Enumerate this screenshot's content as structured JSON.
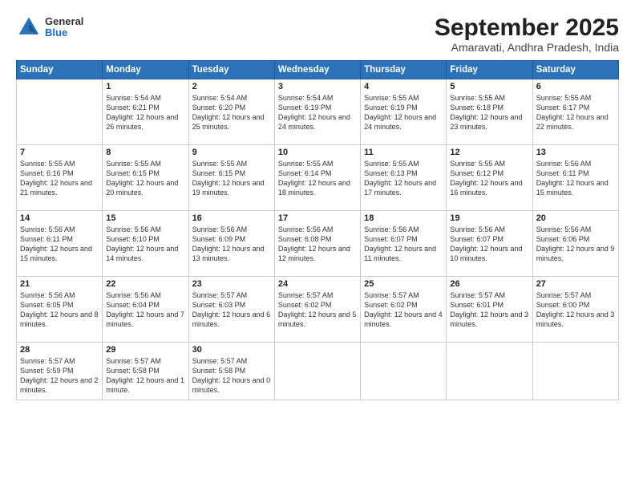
{
  "logo": {
    "general": "General",
    "blue": "Blue"
  },
  "header": {
    "month": "September 2025",
    "location": "Amaravati, Andhra Pradesh, India"
  },
  "days_of_week": [
    "Sunday",
    "Monday",
    "Tuesday",
    "Wednesday",
    "Thursday",
    "Friday",
    "Saturday"
  ],
  "weeks": [
    [
      {
        "day": "",
        "empty": true
      },
      {
        "day": "1",
        "sunrise": "Sunrise: 5:54 AM",
        "sunset": "Sunset: 6:21 PM",
        "daylight": "Daylight: 12 hours and 26 minutes."
      },
      {
        "day": "2",
        "sunrise": "Sunrise: 5:54 AM",
        "sunset": "Sunset: 6:20 PM",
        "daylight": "Daylight: 12 hours and 25 minutes."
      },
      {
        "day": "3",
        "sunrise": "Sunrise: 5:54 AM",
        "sunset": "Sunset: 6:19 PM",
        "daylight": "Daylight: 12 hours and 24 minutes."
      },
      {
        "day": "4",
        "sunrise": "Sunrise: 5:55 AM",
        "sunset": "Sunset: 6:19 PM",
        "daylight": "Daylight: 12 hours and 24 minutes."
      },
      {
        "day": "5",
        "sunrise": "Sunrise: 5:55 AM",
        "sunset": "Sunset: 6:18 PM",
        "daylight": "Daylight: 12 hours and 23 minutes."
      },
      {
        "day": "6",
        "sunrise": "Sunrise: 5:55 AM",
        "sunset": "Sunset: 6:17 PM",
        "daylight": "Daylight: 12 hours and 22 minutes."
      }
    ],
    [
      {
        "day": "7",
        "sunrise": "Sunrise: 5:55 AM",
        "sunset": "Sunset: 6:16 PM",
        "daylight": "Daylight: 12 hours and 21 minutes."
      },
      {
        "day": "8",
        "sunrise": "Sunrise: 5:55 AM",
        "sunset": "Sunset: 6:15 PM",
        "daylight": "Daylight: 12 hours and 20 minutes."
      },
      {
        "day": "9",
        "sunrise": "Sunrise: 5:55 AM",
        "sunset": "Sunset: 6:15 PM",
        "daylight": "Daylight: 12 hours and 19 minutes."
      },
      {
        "day": "10",
        "sunrise": "Sunrise: 5:55 AM",
        "sunset": "Sunset: 6:14 PM",
        "daylight": "Daylight: 12 hours and 18 minutes."
      },
      {
        "day": "11",
        "sunrise": "Sunrise: 5:55 AM",
        "sunset": "Sunset: 6:13 PM",
        "daylight": "Daylight: 12 hours and 17 minutes."
      },
      {
        "day": "12",
        "sunrise": "Sunrise: 5:55 AM",
        "sunset": "Sunset: 6:12 PM",
        "daylight": "Daylight: 12 hours and 16 minutes."
      },
      {
        "day": "13",
        "sunrise": "Sunrise: 5:56 AM",
        "sunset": "Sunset: 6:11 PM",
        "daylight": "Daylight: 12 hours and 15 minutes."
      }
    ],
    [
      {
        "day": "14",
        "sunrise": "Sunrise: 5:56 AM",
        "sunset": "Sunset: 6:11 PM",
        "daylight": "Daylight: 12 hours and 15 minutes."
      },
      {
        "day": "15",
        "sunrise": "Sunrise: 5:56 AM",
        "sunset": "Sunset: 6:10 PM",
        "daylight": "Daylight: 12 hours and 14 minutes."
      },
      {
        "day": "16",
        "sunrise": "Sunrise: 5:56 AM",
        "sunset": "Sunset: 6:09 PM",
        "daylight": "Daylight: 12 hours and 13 minutes."
      },
      {
        "day": "17",
        "sunrise": "Sunrise: 5:56 AM",
        "sunset": "Sunset: 6:08 PM",
        "daylight": "Daylight: 12 hours and 12 minutes."
      },
      {
        "day": "18",
        "sunrise": "Sunrise: 5:56 AM",
        "sunset": "Sunset: 6:07 PM",
        "daylight": "Daylight: 12 hours and 11 minutes."
      },
      {
        "day": "19",
        "sunrise": "Sunrise: 5:56 AM",
        "sunset": "Sunset: 6:07 PM",
        "daylight": "Daylight: 12 hours and 10 minutes."
      },
      {
        "day": "20",
        "sunrise": "Sunrise: 5:56 AM",
        "sunset": "Sunset: 6:06 PM",
        "daylight": "Daylight: 12 hours and 9 minutes."
      }
    ],
    [
      {
        "day": "21",
        "sunrise": "Sunrise: 5:56 AM",
        "sunset": "Sunset: 6:05 PM",
        "daylight": "Daylight: 12 hours and 8 minutes."
      },
      {
        "day": "22",
        "sunrise": "Sunrise: 5:56 AM",
        "sunset": "Sunset: 6:04 PM",
        "daylight": "Daylight: 12 hours and 7 minutes."
      },
      {
        "day": "23",
        "sunrise": "Sunrise: 5:57 AM",
        "sunset": "Sunset: 6:03 PM",
        "daylight": "Daylight: 12 hours and 6 minutes."
      },
      {
        "day": "24",
        "sunrise": "Sunrise: 5:57 AM",
        "sunset": "Sunset: 6:02 PM",
        "daylight": "Daylight: 12 hours and 5 minutes."
      },
      {
        "day": "25",
        "sunrise": "Sunrise: 5:57 AM",
        "sunset": "Sunset: 6:02 PM",
        "daylight": "Daylight: 12 hours and 4 minutes."
      },
      {
        "day": "26",
        "sunrise": "Sunrise: 5:57 AM",
        "sunset": "Sunset: 6:01 PM",
        "daylight": "Daylight: 12 hours and 3 minutes."
      },
      {
        "day": "27",
        "sunrise": "Sunrise: 5:57 AM",
        "sunset": "Sunset: 6:00 PM",
        "daylight": "Daylight: 12 hours and 3 minutes."
      }
    ],
    [
      {
        "day": "28",
        "sunrise": "Sunrise: 5:57 AM",
        "sunset": "Sunset: 5:59 PM",
        "daylight": "Daylight: 12 hours and 2 minutes."
      },
      {
        "day": "29",
        "sunrise": "Sunrise: 5:57 AM",
        "sunset": "Sunset: 5:58 PM",
        "daylight": "Daylight: 12 hours and 1 minute."
      },
      {
        "day": "30",
        "sunrise": "Sunrise: 5:57 AM",
        "sunset": "Sunset: 5:58 PM",
        "daylight": "Daylight: 12 hours and 0 minutes."
      },
      {
        "day": "",
        "empty": true
      },
      {
        "day": "",
        "empty": true
      },
      {
        "day": "",
        "empty": true
      },
      {
        "day": "",
        "empty": true
      }
    ]
  ]
}
